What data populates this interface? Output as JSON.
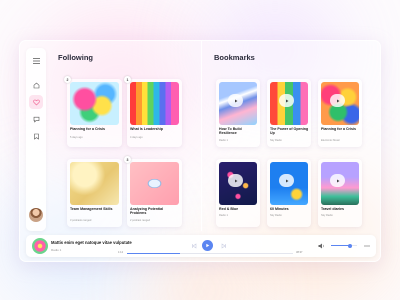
{
  "colors": {
    "accent": "#5b85f1",
    "active_nav": "#f06292",
    "heading": "#2a2a3a"
  },
  "sidebar": {
    "items": [
      {
        "icon": "menu-icon"
      },
      {
        "icon": "home-icon"
      },
      {
        "icon": "heart-icon",
        "active": true
      },
      {
        "icon": "chat-icon"
      },
      {
        "icon": "bookmark-icon"
      }
    ],
    "avatar": "user-avatar"
  },
  "following": {
    "title": "Following",
    "cards": [
      {
        "badge": "2",
        "title": "Planning for a Crisis",
        "sub": "5 days ago"
      },
      {
        "badge": "1",
        "title": "What Is Leadership",
        "sub": "4 days ago"
      },
      {
        "badge": "",
        "title": "Team Management Skills",
        "sub": "3 podcasts ranged"
      },
      {
        "badge": "3",
        "title": "Analyzing Potential Problems",
        "sub": "2 podcast ranged"
      }
    ]
  },
  "bookmarks": {
    "title": "Bookmarks",
    "cards": [
      {
        "title": "How To Build Resilience",
        "sub": "Radio 1"
      },
      {
        "title": "The Power of Opening Up",
        "sub": "Sky Radio"
      },
      {
        "title": "Planning for a Crisis",
        "sub": "Electronic Music"
      },
      {
        "title": "Red & Blue",
        "sub": "Radio 1"
      },
      {
        "title": "60 Minutes",
        "sub": "Sky Radio"
      },
      {
        "title": "Travel diaries",
        "sub": "Sky Radio"
      }
    ]
  },
  "player": {
    "title": "Mattis enim eget natoque vitae vulputate",
    "artist": "Radio 1",
    "elapsed": "1:12",
    "duration": "38:37",
    "progress": 0.32,
    "volume": 0.72
  }
}
